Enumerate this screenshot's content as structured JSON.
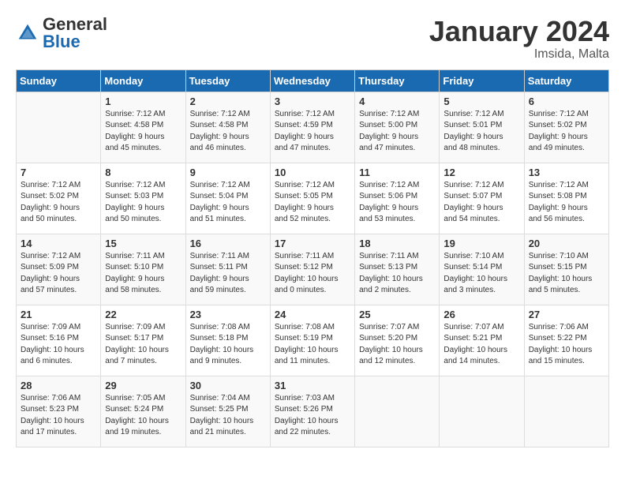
{
  "header": {
    "logo_general": "General",
    "logo_blue": "Blue",
    "month_title": "January 2024",
    "location": "Imsida, Malta"
  },
  "days_of_week": [
    "Sunday",
    "Monday",
    "Tuesday",
    "Wednesday",
    "Thursday",
    "Friday",
    "Saturday"
  ],
  "weeks": [
    [
      {
        "day": "",
        "info": ""
      },
      {
        "day": "1",
        "info": "Sunrise: 7:12 AM\nSunset: 4:58 PM\nDaylight: 9 hours\nand 45 minutes."
      },
      {
        "day": "2",
        "info": "Sunrise: 7:12 AM\nSunset: 4:58 PM\nDaylight: 9 hours\nand 46 minutes."
      },
      {
        "day": "3",
        "info": "Sunrise: 7:12 AM\nSunset: 4:59 PM\nDaylight: 9 hours\nand 47 minutes."
      },
      {
        "day": "4",
        "info": "Sunrise: 7:12 AM\nSunset: 5:00 PM\nDaylight: 9 hours\nand 47 minutes."
      },
      {
        "day": "5",
        "info": "Sunrise: 7:12 AM\nSunset: 5:01 PM\nDaylight: 9 hours\nand 48 minutes."
      },
      {
        "day": "6",
        "info": "Sunrise: 7:12 AM\nSunset: 5:02 PM\nDaylight: 9 hours\nand 49 minutes."
      }
    ],
    [
      {
        "day": "7",
        "info": "Sunrise: 7:12 AM\nSunset: 5:02 PM\nDaylight: 9 hours\nand 50 minutes."
      },
      {
        "day": "8",
        "info": "Sunrise: 7:12 AM\nSunset: 5:03 PM\nDaylight: 9 hours\nand 50 minutes."
      },
      {
        "day": "9",
        "info": "Sunrise: 7:12 AM\nSunset: 5:04 PM\nDaylight: 9 hours\nand 51 minutes."
      },
      {
        "day": "10",
        "info": "Sunrise: 7:12 AM\nSunset: 5:05 PM\nDaylight: 9 hours\nand 52 minutes."
      },
      {
        "day": "11",
        "info": "Sunrise: 7:12 AM\nSunset: 5:06 PM\nDaylight: 9 hours\nand 53 minutes."
      },
      {
        "day": "12",
        "info": "Sunrise: 7:12 AM\nSunset: 5:07 PM\nDaylight: 9 hours\nand 54 minutes."
      },
      {
        "day": "13",
        "info": "Sunrise: 7:12 AM\nSunset: 5:08 PM\nDaylight: 9 hours\nand 56 minutes."
      }
    ],
    [
      {
        "day": "14",
        "info": "Sunrise: 7:12 AM\nSunset: 5:09 PM\nDaylight: 9 hours\nand 57 minutes."
      },
      {
        "day": "15",
        "info": "Sunrise: 7:11 AM\nSunset: 5:10 PM\nDaylight: 9 hours\nand 58 minutes."
      },
      {
        "day": "16",
        "info": "Sunrise: 7:11 AM\nSunset: 5:11 PM\nDaylight: 9 hours\nand 59 minutes."
      },
      {
        "day": "17",
        "info": "Sunrise: 7:11 AM\nSunset: 5:12 PM\nDaylight: 10 hours\nand 0 minutes."
      },
      {
        "day": "18",
        "info": "Sunrise: 7:11 AM\nSunset: 5:13 PM\nDaylight: 10 hours\nand 2 minutes."
      },
      {
        "day": "19",
        "info": "Sunrise: 7:10 AM\nSunset: 5:14 PM\nDaylight: 10 hours\nand 3 minutes."
      },
      {
        "day": "20",
        "info": "Sunrise: 7:10 AM\nSunset: 5:15 PM\nDaylight: 10 hours\nand 5 minutes."
      }
    ],
    [
      {
        "day": "21",
        "info": "Sunrise: 7:09 AM\nSunset: 5:16 PM\nDaylight: 10 hours\nand 6 minutes."
      },
      {
        "day": "22",
        "info": "Sunrise: 7:09 AM\nSunset: 5:17 PM\nDaylight: 10 hours\nand 7 minutes."
      },
      {
        "day": "23",
        "info": "Sunrise: 7:08 AM\nSunset: 5:18 PM\nDaylight: 10 hours\nand 9 minutes."
      },
      {
        "day": "24",
        "info": "Sunrise: 7:08 AM\nSunset: 5:19 PM\nDaylight: 10 hours\nand 11 minutes."
      },
      {
        "day": "25",
        "info": "Sunrise: 7:07 AM\nSunset: 5:20 PM\nDaylight: 10 hours\nand 12 minutes."
      },
      {
        "day": "26",
        "info": "Sunrise: 7:07 AM\nSunset: 5:21 PM\nDaylight: 10 hours\nand 14 minutes."
      },
      {
        "day": "27",
        "info": "Sunrise: 7:06 AM\nSunset: 5:22 PM\nDaylight: 10 hours\nand 15 minutes."
      }
    ],
    [
      {
        "day": "28",
        "info": "Sunrise: 7:06 AM\nSunset: 5:23 PM\nDaylight: 10 hours\nand 17 minutes."
      },
      {
        "day": "29",
        "info": "Sunrise: 7:05 AM\nSunset: 5:24 PM\nDaylight: 10 hours\nand 19 minutes."
      },
      {
        "day": "30",
        "info": "Sunrise: 7:04 AM\nSunset: 5:25 PM\nDaylight: 10 hours\nand 21 minutes."
      },
      {
        "day": "31",
        "info": "Sunrise: 7:03 AM\nSunset: 5:26 PM\nDaylight: 10 hours\nand 22 minutes."
      },
      {
        "day": "",
        "info": ""
      },
      {
        "day": "",
        "info": ""
      },
      {
        "day": "",
        "info": ""
      }
    ]
  ]
}
